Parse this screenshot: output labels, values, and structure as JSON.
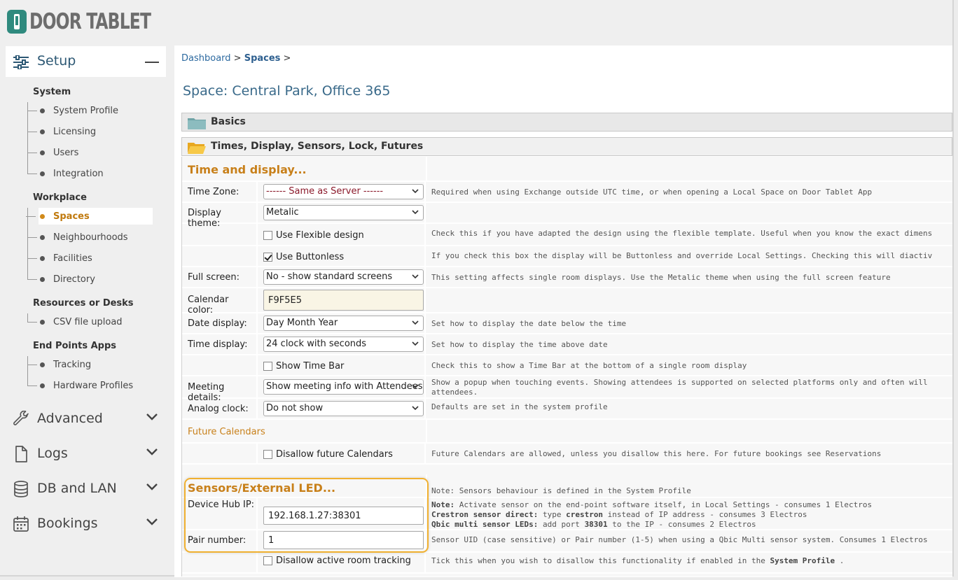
{
  "brand": {
    "name": "DOOR TABLET",
    "accent": "#2f8a7e"
  },
  "sidebar": {
    "setup_label": "Setup",
    "groups": [
      {
        "label": "System",
        "items": [
          "System Profile",
          "Licensing",
          "Users",
          "Integration"
        ]
      },
      {
        "label": "Workplace",
        "items": [
          "Spaces",
          "Neighbourhoods",
          "Facilities",
          "Directory"
        ]
      },
      {
        "label": "Resources or Desks",
        "items": [
          "CSV file upload"
        ]
      },
      {
        "label": "End Points Apps",
        "items": [
          "Tracking",
          "Hardware Profiles"
        ]
      }
    ],
    "active_item": "Spaces",
    "sections": [
      "Advanced",
      "Logs",
      "DB and LAN",
      "Bookings"
    ]
  },
  "breadcrumb": {
    "dashboard": "Dashboard",
    "sep1": " > ",
    "spaces": "Spaces",
    "sep2": " >"
  },
  "page_title": "Space: Central Park, Office 365",
  "panels": {
    "basics": "Basics",
    "times": "Times, Display, Sensors, Lock, Futures"
  },
  "form": {
    "section_time": "Time and display...",
    "time_zone": {
      "label": "Time Zone:",
      "value": "------ Same as Server ------",
      "help": "Required when using Exchange outside UTC time, or when opening a Local Space on Door Tablet App"
    },
    "display_theme": {
      "label": "Display theme:",
      "value": "Metalic"
    },
    "flexible": {
      "label": "Use Flexible design",
      "checked": false,
      "help": "Check this if you have adapted the design using the flexible template.  Useful when you know the exact dimens"
    },
    "buttonless": {
      "label": "Use Buttonless",
      "checked": true,
      "help": "If you check this box the display will be Buttonless and override Local Settings.  Checking this will diactiv"
    },
    "full_screen": {
      "label": "Full screen:",
      "value": "No - show standard screens",
      "help": "This setting affects single room displays.  Use the Metalic theme when using the full screen feature"
    },
    "calendar_color": {
      "label": "Calendar color:",
      "value": "F9F5E5"
    },
    "date_display": {
      "label": "Date display:",
      "value": "Day Month Year",
      "help": "Set how to display the date below the time"
    },
    "time_display": {
      "label": "Time display:",
      "value": "24 clock with seconds",
      "help": "Set how to display the time above date"
    },
    "time_bar": {
      "label": "Show Time Bar",
      "checked": false,
      "help": "Check this to show a Time Bar at the bottom of a single room display"
    },
    "meeting_details": {
      "label": "Meeting details:",
      "value": "Show meeting info with Attendees",
      "help1": "Show a popup when touching events.  Showing attendees is supported on selected platforms only and often will",
      "help2": "attendees."
    },
    "analog_clock": {
      "label": "Analog clock:",
      "value": "Do not show",
      "help": "Defaults are set in the system profile"
    },
    "future_title": "Future Calendars",
    "future": {
      "label": "Disallow future Calendars",
      "checked": false,
      "help": "Future Calendars are allowed, unless you disallow this here.  For future bookings see Reservations"
    },
    "section_sensors": "Sensors/External LED...",
    "sensors_note": "Note: Sensors behaviour is defined in the System Profile",
    "device_hub": {
      "label": "Device Hub IP:",
      "value": "192.168.1.27:38301",
      "help_b1": "Note:",
      "help_t1": " Activate sensor on the end-point software itself, in Local Settings - consumes 1 Electros",
      "help_b2": "Crestron sensor direct:",
      "help_t2a": " type ",
      "help_b2b": "crestron",
      "help_t2c": " instead of IP address - consumes 3 Electros",
      "help_b3": "Qbic multi sensor LEDs:",
      "help_t3a": " add port ",
      "help_b3b": "38301",
      "help_t3c": " to the IP - consumes 2 Electros"
    },
    "pair_number": {
      "label": "Pair number:",
      "value": "1",
      "help": "Sensor UID (case sensitive) or Pair number (1-5) when using a Qbic Multi sensor system. Consumes 1 Electros"
    },
    "active_tracking": {
      "label": "Disallow active room tracking",
      "checked": false,
      "help_a": "Tick this when you wish to disallow this functionality if enabled in the ",
      "help_b": "System Profile",
      "help_c": " ."
    }
  }
}
